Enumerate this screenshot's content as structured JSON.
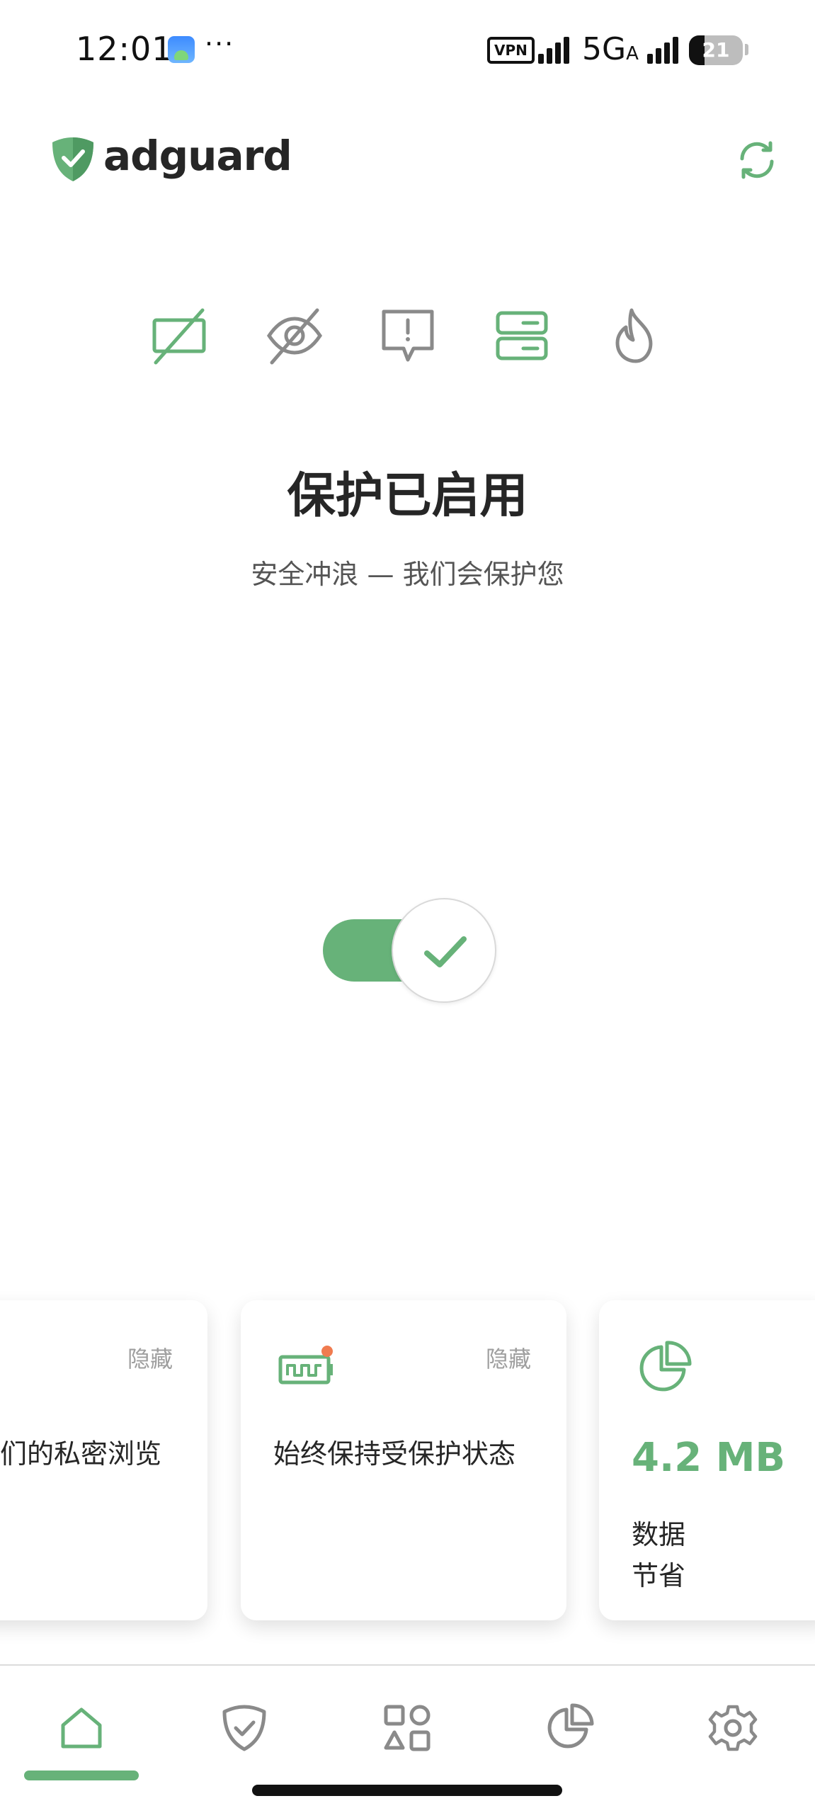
{
  "status_bar": {
    "time": "12:01",
    "dots": "···",
    "vpn": "VPN",
    "network": "5G",
    "network_suffix": "A",
    "battery": "21"
  },
  "header": {
    "logo_text": "adguard",
    "icons": {
      "logo": "adguard-shield-icon",
      "refresh": "refresh-icon"
    }
  },
  "features": [
    {
      "icon": "ad-block-icon",
      "active": true
    },
    {
      "icon": "tracking-protection-icon",
      "active": false
    },
    {
      "icon": "annoyance-block-icon",
      "active": false
    },
    {
      "icon": "dns-server-icon",
      "active": true
    },
    {
      "icon": "firewall-icon",
      "active": false
    }
  ],
  "status": {
    "title": "保护已启用",
    "subtitle": "安全冲浪 — 我们会保护您"
  },
  "toggle": {
    "on": true,
    "icon": "check-icon"
  },
  "cards": [
    {
      "hide_label": "隐藏",
      "text": "们的私密浏览"
    },
    {
      "hide_label": "隐藏",
      "text": "始终保持受保护状态",
      "icon": "battery-alert-icon"
    },
    {
      "value": "4.2 MB",
      "label_line1": "数据",
      "label_line2": "节省",
      "icon": "pie-chart-icon"
    }
  ],
  "bottom_nav": {
    "items": [
      "home-icon",
      "shield-check-icon",
      "apps-icon",
      "statistics-icon",
      "settings-icon"
    ],
    "active_index": 0
  },
  "colors": {
    "accent": "#67b279",
    "text": "#262626",
    "subtext": "#555555",
    "muted": "#9e9e9e",
    "icon_gray": "#8a8a8a",
    "alert_dot": "#f07b4f"
  }
}
